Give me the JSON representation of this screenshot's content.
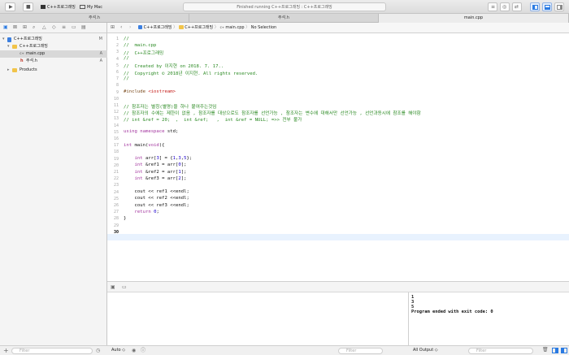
{
  "toolbar": {
    "scheme": "C++프로그래밍",
    "destination": "My Mac",
    "status": "Finished running C++프로그래밍 : C++프로그래밍"
  },
  "tabs": [
    {
      "label": "주석.h"
    },
    {
      "label": "주석.h"
    },
    {
      "label": "main.cpp"
    }
  ],
  "navigator": {
    "items": [
      {
        "label": "C++프로그래밍",
        "badge": "M"
      },
      {
        "label": "C++프로그래밍",
        "badge": ""
      },
      {
        "label": "main.cpp",
        "badge": "A"
      },
      {
        "label": "주석.h",
        "badge": "A"
      },
      {
        "label": "Products",
        "badge": ""
      }
    ],
    "filter_placeholder": "Filter"
  },
  "jumpbar": {
    "project": "C++프로그래밍",
    "group": "C++프로그래밍",
    "file": "main.cpp",
    "selection": "No Selection"
  },
  "code_lines": [
    "//",
    "//  main.cpp",
    "//  C++프로그래밍",
    "//",
    "//  Created by 이지현 on 2018. 7. 17..",
    "//  Copyright © 2018년 이지현. All rights reserved.",
    "//",
    "",
    "#include <iostream>",
    "",
    "// 참조자는 별칭(별명)을 하나 붙여주는것임",
    "// 참조자의 수에는 제한이 없음 , 참조자를 대상으로도 참조자를 선언가능 , 참조자는 변수에 대해서만 선언가능 , 선언과동시에 참조를 해야함",
    "// int &ref = 20;  ,  int &ref;   ,  int &ref = NULL; =>> 전부 불가",
    "",
    "using namespace std;",
    "",
    "int main(void){",
    "",
    "    int arr[3] = {1,3,5};",
    "    int &ref1 = arr[0];",
    "    int &ref2 = arr[1];",
    "    int &ref3 = arr[2];",
    "",
    "    cout << ref1 <<endl;",
    "    cout << ref2 <<endl;",
    "    cout << ref3 <<endl;",
    "    return 0;",
    "}",
    "",
    ""
  ],
  "line_numbers": [
    "1",
    "2",
    "3",
    "4",
    "5",
    "6",
    "7",
    "8",
    "9",
    "10",
    "11",
    "12",
    "13",
    "14",
    "15",
    "16",
    "17",
    "18",
    "19",
    "20",
    "21",
    "22",
    "23",
    "24",
    "25",
    "26",
    "27",
    "28",
    "29",
    "30"
  ],
  "console": {
    "output_lines": [
      "1",
      "3",
      "5",
      "Program ended with exit code: 0"
    ],
    "output_selector": "All Output ◇",
    "filter_placeholder": "Filter"
  },
  "variables": {
    "scope_selector": "Auto ◇",
    "filter_placeholder": "Filter"
  },
  "colors": {
    "comment": "#2b8a23",
    "keyword": "#a2349e",
    "preprocessor": "#7a4a1c",
    "string": "#c41a16",
    "number": "#1c00cf",
    "accent": "#2a7ae2"
  }
}
